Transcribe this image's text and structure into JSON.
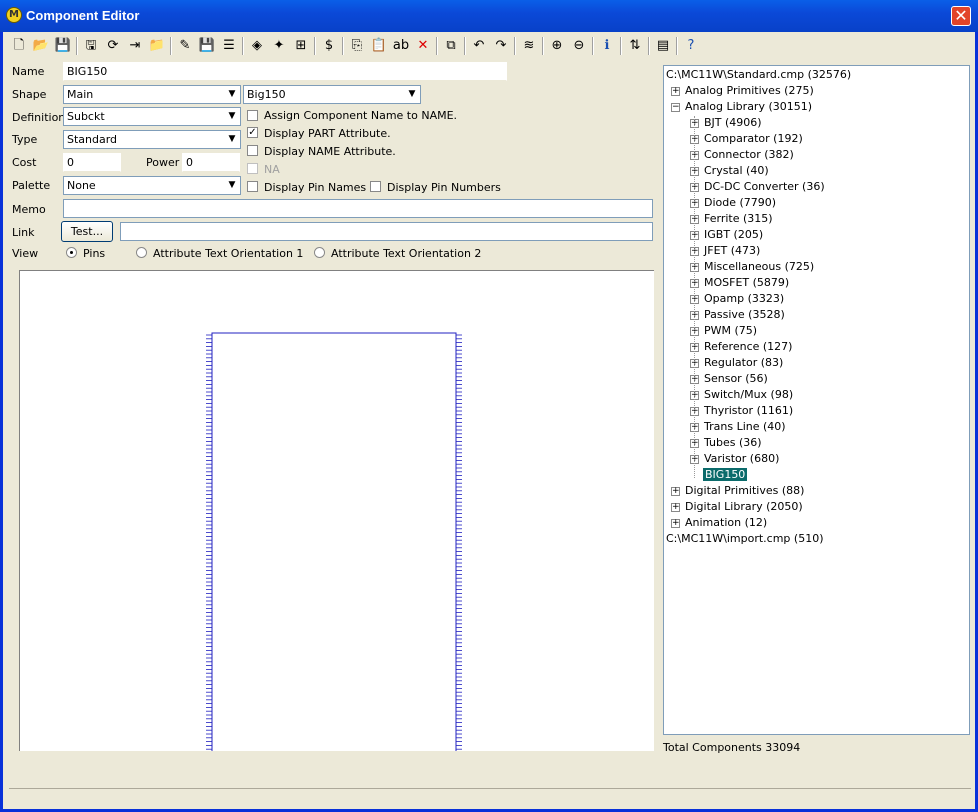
{
  "window": {
    "title": "Component Editor",
    "close_glyph": "✕"
  },
  "toolbar": {
    "icons": [
      "new-icon",
      "open-icon",
      "save-icon",
      "save-as-icon",
      "refresh-icon",
      "insert-icon",
      "folder-icon",
      "tool-icon",
      "floppy-icon",
      "list-icon",
      "paint-icon",
      "marker-icon",
      "pin-icon",
      "dollar-icon",
      "copy-icon",
      "paste-icon",
      "rename-icon",
      "delete-icon",
      "merge-icon",
      "undo-icon",
      "redo-icon",
      "find-icon",
      "zoom-in-icon",
      "zoom-out-icon",
      "info-icon",
      "sort-icon",
      "properties-icon",
      "help-icon"
    ]
  },
  "form": {
    "name_label": "Name",
    "name_value": "BIG150",
    "shape_label": "Shape",
    "shape_value": "Main",
    "shape_value2": "Big150",
    "definition_label": "Definition",
    "definition_value": "Subckt",
    "type_label": "Type",
    "type_value": "Standard",
    "cost_label": "Cost",
    "cost_value": "0",
    "power_label": "Power",
    "power_value": "0",
    "palette_label": "Palette",
    "palette_value": "None",
    "memo_label": "Memo",
    "memo_value": "",
    "link_label": "Link",
    "test_button": "Test...",
    "link_value": "",
    "view_label": "View"
  },
  "options": {
    "assign_name": {
      "label": "Assign Component Name to NAME.",
      "checked": false
    },
    "display_part": {
      "label": "Display PART Attribute.",
      "checked": true
    },
    "display_name": {
      "label": "Display NAME Attribute.",
      "checked": false
    },
    "na": {
      "label": "NA",
      "checked": false
    },
    "display_pin_names": {
      "label": "Display Pin Names",
      "checked": false
    },
    "display_pin_numbers": {
      "label": "Display Pin Numbers",
      "checked": false
    }
  },
  "view": {
    "pins": {
      "label": "Pins",
      "selected": true
    },
    "orient1": {
      "label": "Attribute Text Orientation 1",
      "selected": false
    },
    "orient2": {
      "label": "Attribute Text Orientation 2",
      "selected": false
    }
  },
  "tree": {
    "root": "C:\\MC11W\\Standard.cmp (32576)",
    "groups": [
      {
        "label": "Analog Primitives (275)",
        "expanded": false
      },
      {
        "label": "Analog Library (30151)",
        "expanded": true
      }
    ],
    "children": [
      "BJT (4906)",
      "Comparator (192)",
      "Connector (382)",
      "Crystal (40)",
      "DC-DC Converter (36)",
      "Diode (7790)",
      "Ferrite (315)",
      "IGBT (205)",
      "JFET (473)",
      "Miscellaneous (725)",
      "MOSFET (5879)",
      "Opamp (3323)",
      "Passive (3528)",
      "PWM (75)",
      "Reference (127)",
      "Regulator (83)",
      "Sensor (56)",
      "Switch/Mux (98)",
      "Thyristor (1161)",
      "Trans Line (40)",
      "Tubes (36)",
      "Varistor (680)"
    ],
    "selected": "BIG150",
    "more_groups": [
      "Digital Primitives (88)",
      "Digital Library (2050)",
      "Animation (12)"
    ],
    "root2": "C:\\MC11W\\import.cmp (510)"
  },
  "footer": {
    "total": "Total Components 33094"
  }
}
